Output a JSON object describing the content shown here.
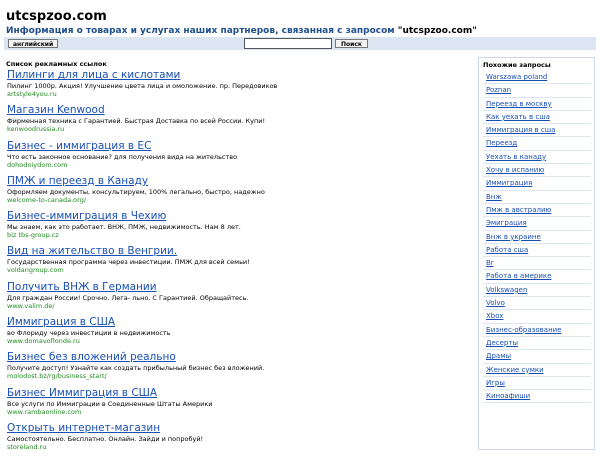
{
  "header": {
    "site_title": "utcspzoo.com",
    "subtitle_prefix": "Информация о товарах и услугах наших партнеров, связанная с запросом ",
    "subtitle_query": "\"utcspzoo.com\""
  },
  "toolbar": {
    "language_button": "английский",
    "search_value": "",
    "search_button": "Поиск"
  },
  "ads_section": {
    "heading": "Список рекламных ссылок",
    "items": [
      {
        "title": "Пилинги для лица с кислотами",
        "description": "Пилинг 1000р. Акция! Улучшение цвета лица и омоложение. пр. Передовиков",
        "url": "artstyle4you.ru"
      },
      {
        "title": "Магазин Kenwood",
        "description": "Фирменная техника с Гарантией. Быстрая Доставка по всей России. Купи!",
        "url": "kenwoodrussia.ru"
      },
      {
        "title": "Бизнес - иммиграция в ЕС",
        "description": "Что есть законное основание? для получения вида на жительство",
        "url": "dohodniydom.com"
      },
      {
        "title": "ПМЖ и переезд в Канаду",
        "description": "Оформляем документы, консультируем, 100% легально, быстро, надежно",
        "url": "welcome-to-canada.org/"
      },
      {
        "title": "Бизнес-иммиграция в Чехию",
        "description": "Мы знаем, как это работает. ВНЖ, ПМЖ, недвижимость. Нам 8 лет.",
        "url": "biz tbs-group.cz"
      },
      {
        "title": "Вид на жительство в Венгрии.",
        "description": "Государственная программа через инвестиции. ПМЖ для всей семьи!",
        "url": "voldangroup.com"
      },
      {
        "title": "Получить ВНЖ в Германии",
        "description": "Для граждан России! Срочно. Лега- льно. С Гарантией. Обращайтесь.",
        "url": "www.valim.de/"
      },
      {
        "title": "Иммиграция в США",
        "description": "во Флориду через инвестиции в недвижимость",
        "url": "www.domavoflonde.ru"
      },
      {
        "title": "Бизнес без вложений реально",
        "description": "Получите доступ! Узнайте как создать прибыльный бизнес без вложений.",
        "url": "molodost.bz/rg/business_start/"
      },
      {
        "title": "Бизнес Иммиграция в США",
        "description": "Все услуги по Иммиграции в Соединенные Штаты Америки",
        "url": "www.rambaonline.com"
      },
      {
        "title": "Открыть интернет-магазин",
        "description": "Самостоятельно. Бесплатно. Онлайн. Зайди и попробуй!",
        "url": "storeland.ru"
      }
    ]
  },
  "related": {
    "heading": "Похожие запросы",
    "items": [
      "Warszawa poland",
      "Poznan",
      "Переезд в москву",
      "Как уехать в сша",
      "Иммиграция в сша",
      "Переезд",
      "Уехать в канаду",
      "Хочу в испанию",
      "Иммиграция",
      "Внж",
      "Пмж в австралию",
      "Эмиграция",
      "Внж в украине",
      "Работа сша",
      "Br",
      "Работа в америке",
      "Volkswagen",
      "Volvo",
      "Xbox",
      "Бизнес-образование",
      "Десерты",
      "Драмы",
      "Женские сумки",
      "Игры",
      "Киноафиши"
    ]
  }
}
